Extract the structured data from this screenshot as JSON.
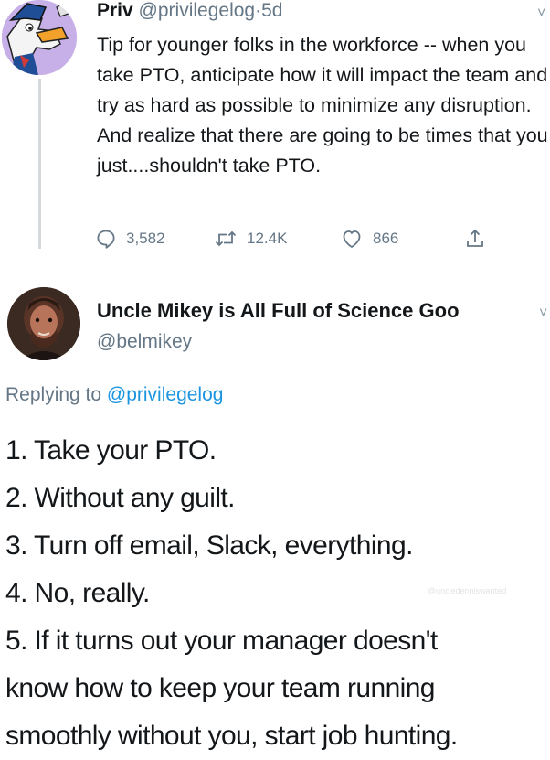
{
  "tweet1": {
    "display_name": "Priv",
    "handle": "@privilegelog",
    "separator": "·",
    "time": "5d",
    "caret": "˅",
    "text": "Tip for younger folks in the workforce -- when you take PTO, anticipate how it will impact the team and try as hard as possible to minimize any disruption. And realize that there are going to be times that you just....shouldn't take PTO.",
    "actions": {
      "reply_count": "3,582",
      "retweet_count": "12.4K",
      "like_count": "866"
    },
    "icons": [
      "reply-icon",
      "retweet-icon",
      "like-icon",
      "share-icon"
    ]
  },
  "tweet2": {
    "display_name": "Uncle Mikey is All Full of Science Goo",
    "handle": "@belmikey",
    "caret": "˅",
    "replying_prefix": "Replying to",
    "replying_to": "@privilegelog",
    "lines": [
      "1. Take your PTO.",
      "2. Without any guilt.",
      "3. Turn off email, Slack, everything.",
      "4. No, really.",
      "5. If it turns out your manager doesn't",
      "know how to keep your team running",
      "smoothly without you, start job hunting."
    ]
  },
  "watermark": "@uncledenniswanted",
  "colors": {
    "text": "#14171a",
    "secondary": "#657786",
    "link": "#1b95e0",
    "thread_line": "#d6d9dc"
  }
}
